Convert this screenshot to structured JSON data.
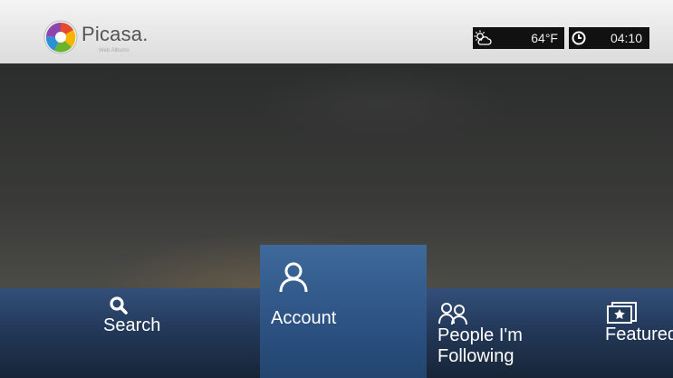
{
  "header": {
    "logo_title": "Picasa.",
    "logo_subtitle": "Web Albums",
    "weather": {
      "icon": "partly-cloudy-icon",
      "temperature": "64°F"
    },
    "clock": {
      "icon": "clock-icon",
      "time": "04:10"
    }
  },
  "menu": {
    "items": [
      {
        "label": "Search",
        "icon": "search-icon"
      },
      {
        "label": "Account",
        "icon": "person-icon",
        "selected": true
      },
      {
        "label": "People I'm\nFollowing",
        "line1": "People I'm",
        "line2": "Following",
        "icon": "people-icon"
      },
      {
        "label": "Featured",
        "icon": "featured-photos-icon"
      }
    ]
  },
  "colors": {
    "menu_bar": "#23395a",
    "menu_selected": "#2c5283",
    "topbar": "#e8e8e8"
  }
}
